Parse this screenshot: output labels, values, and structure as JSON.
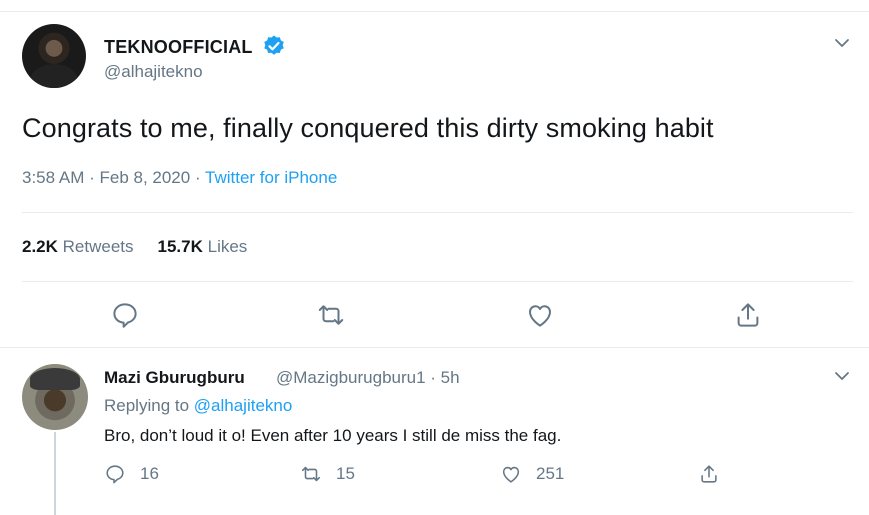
{
  "tweet": {
    "display_name": "TEKNOOFFICIAL",
    "handle": "@alhajitekno",
    "text": "Congrats to me, finally conquered this dirty smoking habit",
    "time": "3:58 AM · Feb 8, 2020 · ",
    "source": "Twitter for iPhone",
    "retweets_count": "2.2K",
    "retweets_label": " Retweets",
    "likes_count": "15.7K",
    "likes_label": " Likes"
  },
  "reply": {
    "display_name": "Mazi Gburugburu",
    "handle_time": "@Mazigburugburu1 · 5h",
    "replying_prefix": "Replying to ",
    "replying_handle": "@alhajitekno",
    "text": "Bro, don’t loud it o! Even after 10 years I still de miss the fag.",
    "reply_count": "16",
    "retweet_count": "15",
    "like_count": "251"
  },
  "colors": {
    "accent": "#1da1f2",
    "secondary_text": "#657786",
    "divider": "#e6ecf0"
  },
  "icons": [
    "verified-badge-icon",
    "chevron-down-icon",
    "reply-icon",
    "retweet-icon",
    "like-icon",
    "share-icon"
  ]
}
